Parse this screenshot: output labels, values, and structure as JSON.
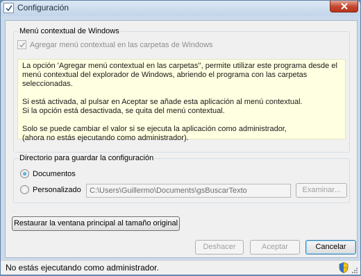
{
  "window": {
    "title": "Configuración",
    "icon": "checkbox-app-icon",
    "close_icon": "close-icon"
  },
  "context_group": {
    "title": "Menú contextual de Windows",
    "checkbox_label": "Agregar menú contextual en las carpetas de Windows",
    "checkbox_checked": true,
    "checkbox_enabled": false,
    "info_paragraphs": [
      "La opción 'Agregar menú contextual en las carpetas'', permite utilizar este programa desde el menú contextual del explorador de Windows, abriendo el programa con las carpetas seleccionadas.",
      "Si está activada, al pulsar en Aceptar se añade esta aplicación al menú contextual.\nSi la opción está desactivada, se quita del menú contextual.",
      "Solo se puede cambiar el valor si se ejecuta la aplicación como administrador,\n(ahora no estás ejecutando como administrador)."
    ]
  },
  "dir_group": {
    "title": "Directorio para guardar la configuración",
    "option_documents": "Documentos",
    "option_custom": "Personalizado",
    "selected": "Documentos",
    "path_value": "C:\\Users\\Guillermo\\Documents\\gsBuscarTexto",
    "browse_label": "Examinar..."
  },
  "buttons": {
    "restore_label": "Restaurar la ventana principal al tamaño original",
    "undo_label": "Deshacer",
    "accept_label": "Aceptar",
    "cancel_label": "Cancelar"
  },
  "status": {
    "text": "No estás ejecutando como administrador.",
    "icon": "uac-shield-icon"
  },
  "colors": {
    "info_background": "#ffffe1",
    "disabled_text": "#a0a0a0"
  }
}
